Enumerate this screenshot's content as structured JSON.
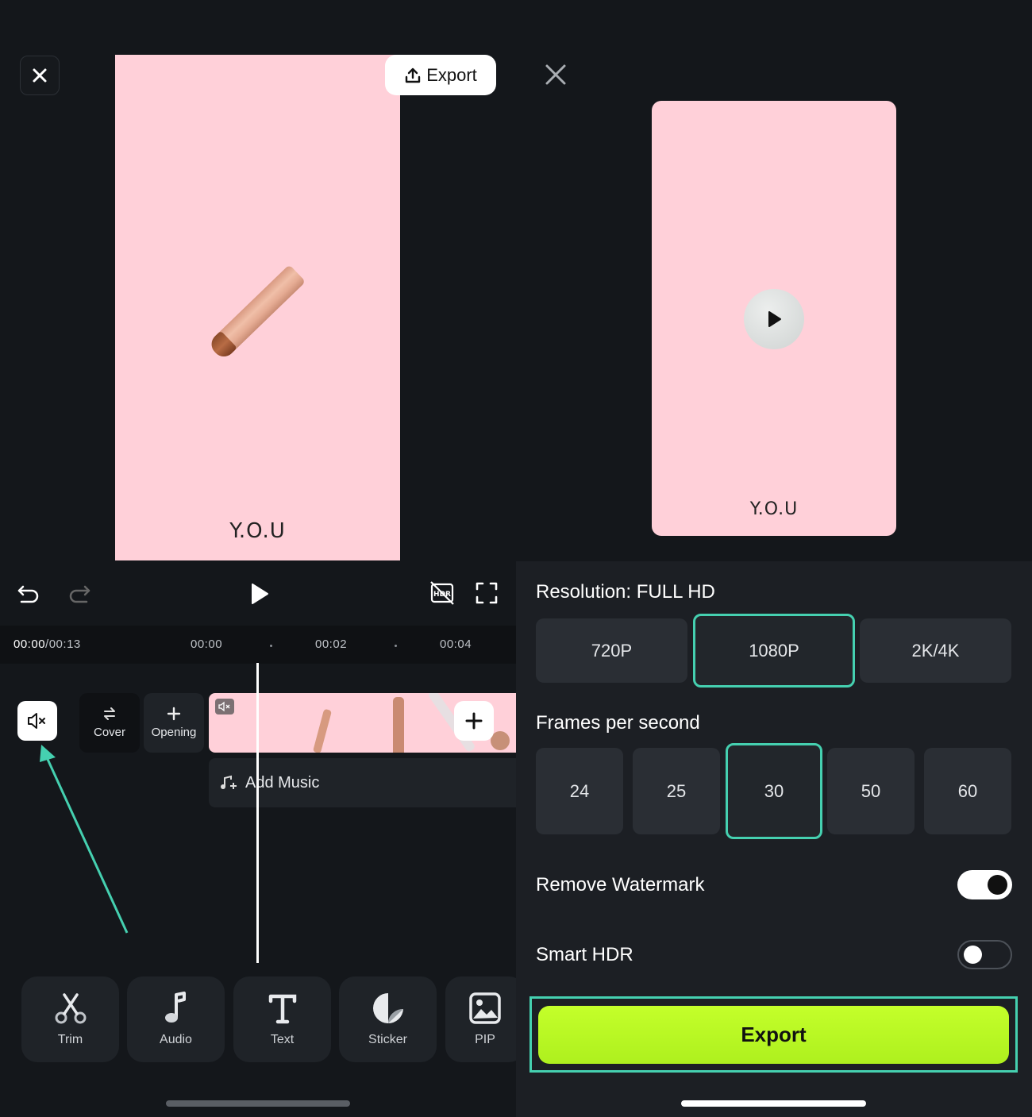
{
  "editor": {
    "export_label": "Export",
    "brand": "Y.O.U",
    "time_current": "00:00",
    "time_total": "/00:13",
    "ruler": [
      "00:00",
      "00:02",
      "00:04"
    ],
    "cover_label": "Cover",
    "opening_label": "Opening",
    "add_music_label": "Add Music",
    "tools": [
      {
        "label": "Trim",
        "icon": "scissors-icon"
      },
      {
        "label": "Audio",
        "icon": "music-note-icon"
      },
      {
        "label": "Text",
        "icon": "text-icon"
      },
      {
        "label": "Sticker",
        "icon": "sticker-icon"
      },
      {
        "label": "PIP",
        "icon": "pip-icon"
      }
    ]
  },
  "export_settings": {
    "brand": "Y.O.U",
    "resolution_label": "Resolution: FULL HD",
    "resolutions": [
      "720P",
      "1080P",
      "2K/4K"
    ],
    "resolution_selected": "1080P",
    "fps_label": "Frames per second",
    "fps_options": [
      "24",
      "25",
      "30",
      "50",
      "60"
    ],
    "fps_selected": "30",
    "remove_watermark_label": "Remove Watermark",
    "remove_watermark_on": true,
    "smart_hdr_label": "Smart HDR",
    "smart_hdr_on": false,
    "export_button": "Export"
  },
  "colors": {
    "accent": "#45d0b0",
    "export_green": "#b8f823",
    "preview_pink": "#ffd0d9",
    "background": "#14171b"
  }
}
